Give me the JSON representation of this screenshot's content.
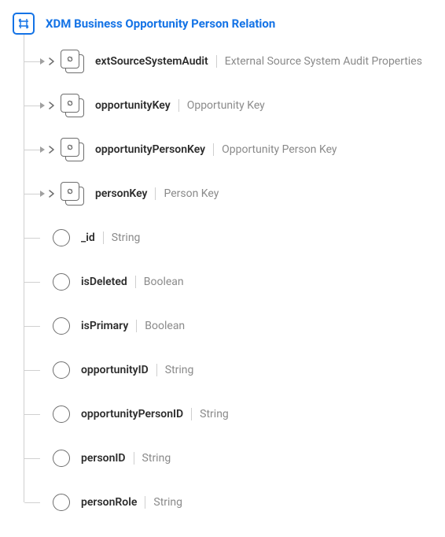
{
  "root": {
    "title": "XDM Business Opportunity Person Relation"
  },
  "fields": [
    {
      "kind": "object",
      "name": "extSourceSystemAudit",
      "type": "External Source System Audit Properties"
    },
    {
      "kind": "object",
      "name": "opportunityKey",
      "type": "Opportunity Key"
    },
    {
      "kind": "object",
      "name": "opportunityPersonKey",
      "type": "Opportunity Person Key"
    },
    {
      "kind": "object",
      "name": "personKey",
      "type": "Person Key"
    },
    {
      "kind": "leaf",
      "name": "_id",
      "type": "String"
    },
    {
      "kind": "leaf",
      "name": "isDeleted",
      "type": "Boolean"
    },
    {
      "kind": "leaf",
      "name": "isPrimary",
      "type": "Boolean"
    },
    {
      "kind": "leaf",
      "name": "opportunityID",
      "type": "String"
    },
    {
      "kind": "leaf",
      "name": "opportunityPersonID",
      "type": "String"
    },
    {
      "kind": "leaf",
      "name": "personID",
      "type": "String"
    },
    {
      "kind": "leaf",
      "name": "personRole",
      "type": "String"
    }
  ]
}
